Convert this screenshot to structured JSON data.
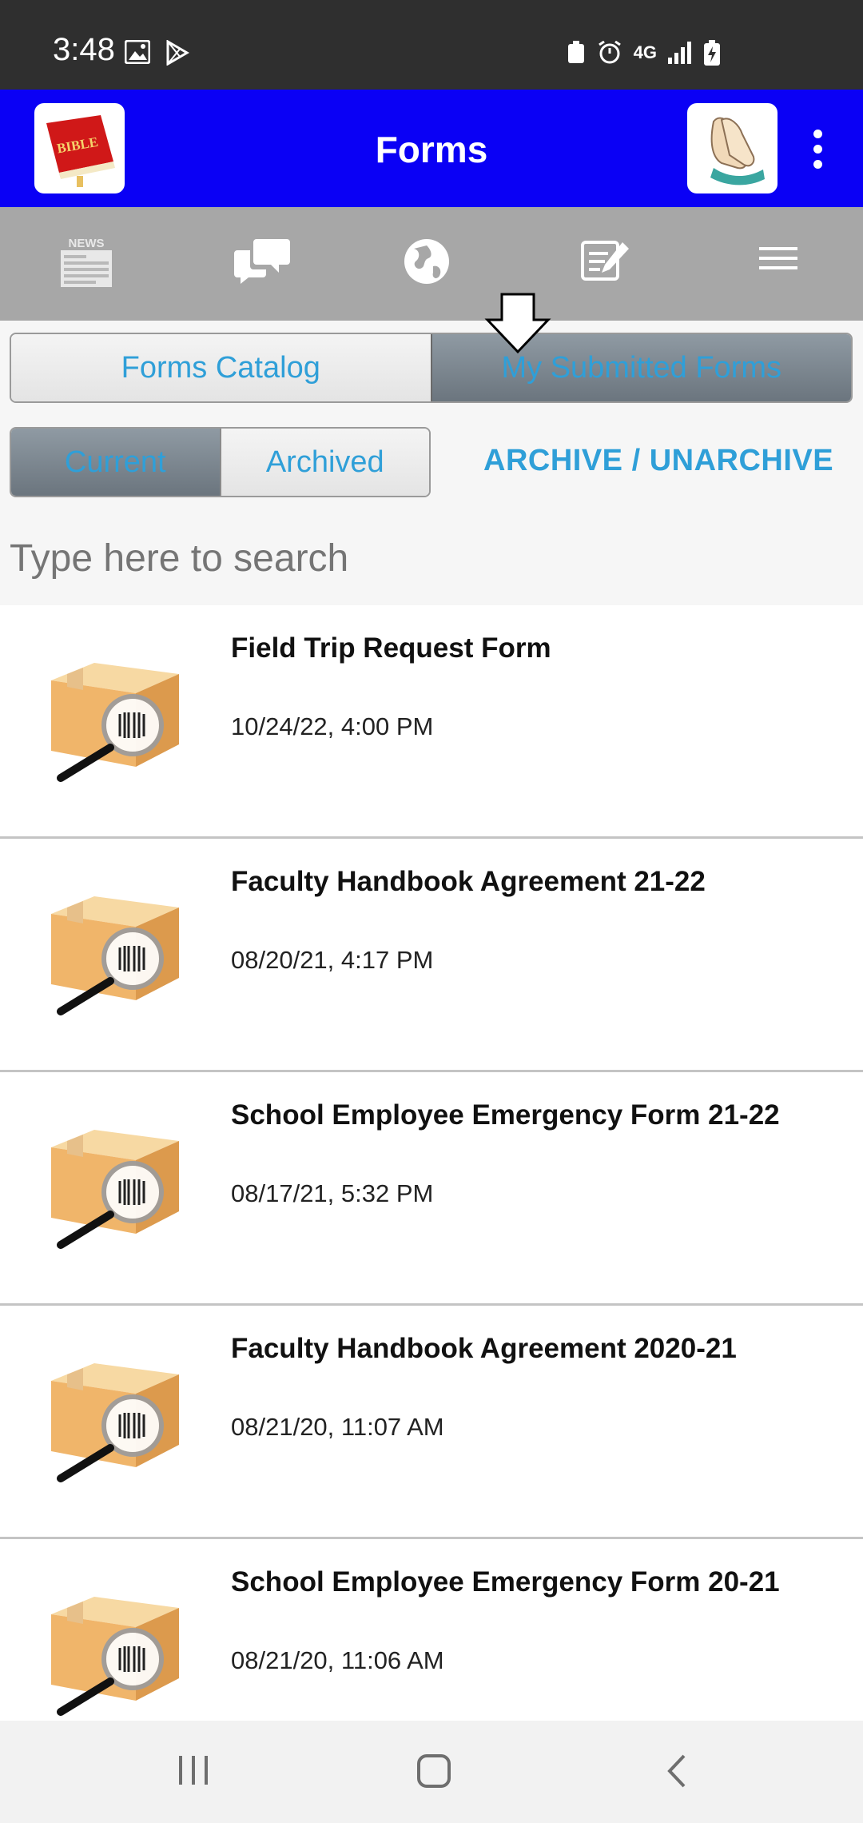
{
  "status_bar": {
    "time": "3:48",
    "network": "4G"
  },
  "header": {
    "title": "Forms"
  },
  "nav_icons": [
    "news-icon",
    "chat-icon",
    "globe-icon",
    "note-edit-icon",
    "menu-icon"
  ],
  "tabs": {
    "catalog_label": "Forms Catalog",
    "submitted_label": "My Submitted Forms",
    "selected": "My Submitted Forms"
  },
  "filter_tabs": {
    "current_label": "Current",
    "archived_label": "Archived",
    "selected": "Current"
  },
  "archive_button_label": "ARCHIVE / UNARCHIVE",
  "search": {
    "placeholder": "Type here to search"
  },
  "forms": [
    {
      "title": "Field Trip Request Form",
      "date": "10/24/22, 4:00 PM"
    },
    {
      "title": "Faculty Handbook Agreement 21-22",
      "date": "08/20/21, 4:17 PM"
    },
    {
      "title": "School Employee Emergency Form 21-22",
      "date": "08/17/21, 5:32 PM"
    },
    {
      "title": "Faculty Handbook Agreement 2020-21",
      "date": "08/21/20, 11:07 AM"
    },
    {
      "title": "School Employee Emergency Form 20-21",
      "date": "08/21/20, 11:06 AM"
    }
  ],
  "colors": {
    "header_bg": "#0a00f5",
    "nav_strip_bg": "#a7a7a7",
    "accent_text": "#2f9fd8",
    "active_segment": "#7d8790"
  }
}
